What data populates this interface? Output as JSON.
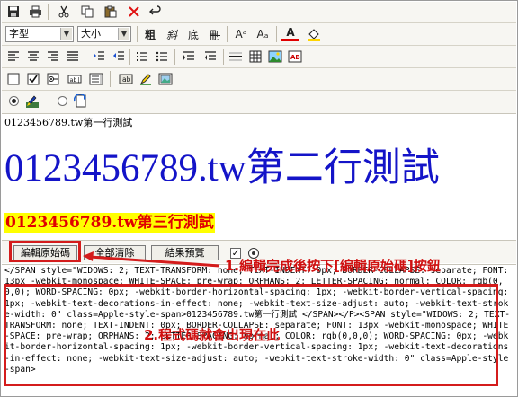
{
  "toolbar": {
    "row1_icons": [
      "save-icon",
      "print-icon",
      "cut-icon",
      "copy-icon",
      "paste-icon",
      "delete-icon",
      "undo-icon"
    ],
    "font_select": "字型",
    "size_select": "大小",
    "bold_label": "粗",
    "italic_label": "斜",
    "underline_label": "底",
    "strike_label": "刪",
    "sup_label": "Aᵃ",
    "sub_label": "Aₐ",
    "text_color_label": "A",
    "row3_icons": [
      "align-left-icon",
      "align-center-icon",
      "align-right-icon",
      "justify-icon",
      "indent-icon",
      "outdent-icon",
      "ordered-list-icon",
      "unordered-list-icon",
      "horizontal-rule-icon",
      "table-icon",
      "image-icon",
      "text-box-icon"
    ],
    "row4_icons": [
      "form-icon",
      "checkbox-icon",
      "radio-icon",
      "textfield-icon",
      "textarea-icon",
      "button-icon",
      "marker-icon",
      "picture-icon"
    ],
    "mode_design_icon": "design-mode-icon",
    "mode_source_icon": "source-mode-icon"
  },
  "content": {
    "line1": "0123456789.tw第一行測試",
    "line2": "0123456789.tw第二行測試",
    "line3": "0123456789.tw第三行測試"
  },
  "mode_bar": {
    "edit_source": "編輯原始碼",
    "clear_all": "全部清除",
    "preview": "結果預覽",
    "check": "✓"
  },
  "source": {
    "text": "</SPAN style=\"WIDOWS: 2; TEXT-TRANSFORM: none; TEXT-INDENT: 0px; BORDER-COLLAPSE: separate; FONT: 13px -webkit-monospace; WHITE-SPACE: pre-wrap; ORPHANS: 2; LETTER-SPACING: normal; COLOR: rgb(0,0,0); WORD-SPACING: 0px; -webkit-border-horizontal-spacing: 1px; -webkit-border-vertical-spacing: 1px; -webkit-text-decorations-in-effect: none; -webkit-text-size-adjust: auto; -webkit-text-stroke-width: 0\" class=Apple-style-span>0123456789.tw第一行測試 </SPAN></P><SPAN style=\"WIDOWS: 2; TEXT-TRANSFORM: none; TEXT-INDENT: 0px; BORDER-COLLAPSE: separate; FONT: 13px -webkit-monospace; WHITE-SPACE: pre-wrap; ORPHANS: 2; LETTER-SPACING: normal; COLOR: rgb(0,0,0); WORD-SPACING: 0px; -webkit-border-horizontal-spacing: 1px; -webkit-border-vertical-spacing: 1px; -webkit-text-decorations-in-effect: none; -webkit-text-size-adjust: auto; -webkit-text-stroke-width: 0\" class=Apple-style-span>"
  },
  "annotations": {
    "callout1": "1.編輯完成後按下[編輯原始碼]按鈕",
    "callout2": "2.程式碼就會出現在此",
    "color": "#d41c1c"
  }
}
